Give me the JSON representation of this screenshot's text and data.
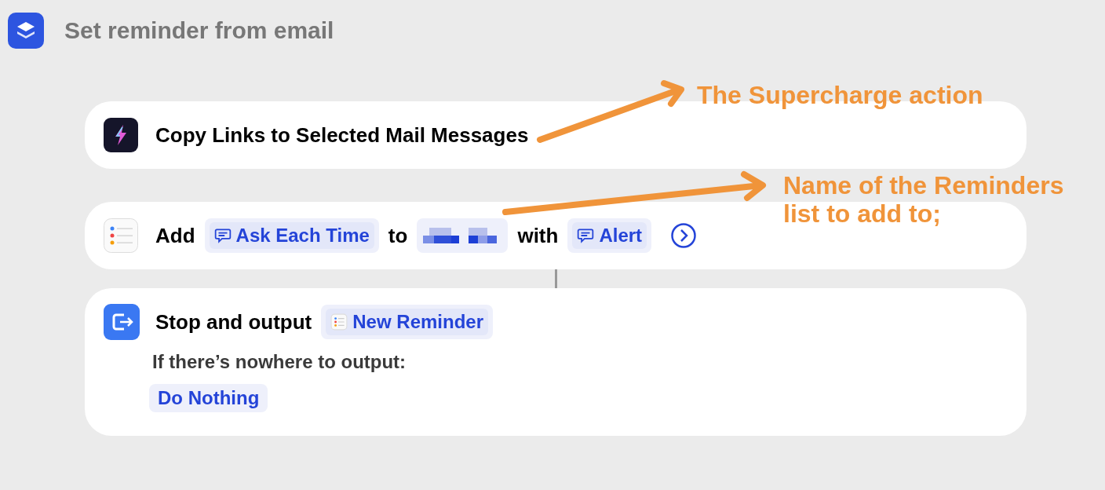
{
  "title": "Set reminder from email",
  "actions": [
    {
      "parts": [
        {
          "kind": "text",
          "text": "Copy Links to Selected Mail Messages"
        }
      ]
    },
    {
      "parts": [
        {
          "kind": "text",
          "text": "Add"
        },
        {
          "kind": "ask",
          "text": "Ask Each Time"
        },
        {
          "kind": "text",
          "text": "to"
        },
        {
          "kind": "redacted"
        },
        {
          "kind": "text",
          "text": "with"
        },
        {
          "kind": "ask",
          "text": "Alert"
        },
        {
          "kind": "more"
        }
      ]
    },
    {
      "parts": [
        {
          "kind": "text",
          "text": "Stop and output"
        },
        {
          "kind": "output",
          "text": "New Reminder"
        }
      ],
      "sub_label": "If there’s nowhere to output:",
      "sub_value": "Do Nothing"
    }
  ],
  "annotations": [
    {
      "text": "The Supercharge action"
    },
    {
      "text": "Name of the Reminders list to add to;"
    }
  ]
}
